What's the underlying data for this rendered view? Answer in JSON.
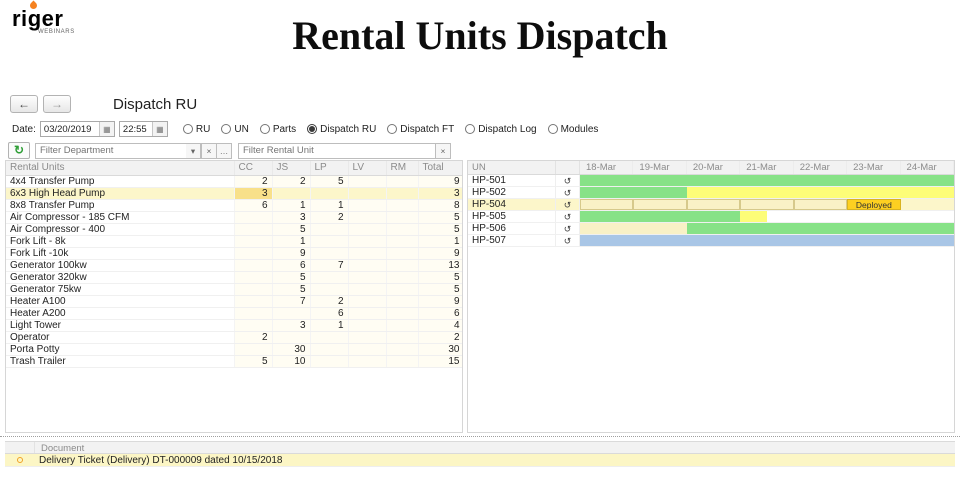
{
  "logo": {
    "text_pre": "ri",
    "text_mid": "g",
    "text_post": "er",
    "subtitle": "WEBINARS"
  },
  "page_title": "Rental Units Dispatch",
  "toolbar": {
    "title": "Dispatch RU"
  },
  "icons": {
    "back": "←",
    "forward": "→",
    "calendar": "▦",
    "refresh": "↻",
    "dropdown": "▾",
    "clear": "×",
    "choose": "…",
    "history": "↺"
  },
  "date_row": {
    "date_label": "Date:",
    "date_value": "03/20/2019",
    "time_value": "22:55",
    "radios": [
      {
        "label": "RU",
        "checked": false
      },
      {
        "label": "UN",
        "checked": false
      },
      {
        "label": "Parts",
        "checked": false
      },
      {
        "label": "Dispatch RU",
        "checked": true
      },
      {
        "label": "Dispatch FT",
        "checked": false
      },
      {
        "label": "Dispatch Log",
        "checked": false
      },
      {
        "label": "Modules",
        "checked": false
      }
    ]
  },
  "filters": {
    "department_placeholder": "Filter Department",
    "rental_unit_placeholder": "Filter Rental Unit"
  },
  "rental_table": {
    "columns": [
      "Rental Units",
      "CC",
      "JS",
      "LP",
      "LV",
      "RM",
      "Total"
    ],
    "rows": [
      {
        "name": "4x4 Transfer Pump",
        "cc": "2",
        "js": "2",
        "lp": "5",
        "lv": "",
        "rm": "",
        "total": "9"
      },
      {
        "name": "6x3 High Head Pump",
        "cc": "3",
        "js": "",
        "lp": "",
        "lv": "",
        "rm": "",
        "total": "3",
        "selected": true,
        "highlight_cell": "cc"
      },
      {
        "name": "8x8 Transfer Pump",
        "cc": "6",
        "js": "1",
        "lp": "1",
        "lv": "",
        "rm": "",
        "total": "8"
      },
      {
        "name": "Air Compressor - 185 CFM",
        "cc": "",
        "js": "3",
        "lp": "2",
        "lv": "",
        "rm": "",
        "total": "5"
      },
      {
        "name": "Air Compressor - 400",
        "cc": "",
        "js": "5",
        "lp": "",
        "lv": "",
        "rm": "",
        "total": "5"
      },
      {
        "name": "Fork Lift - 8k",
        "cc": "",
        "js": "1",
        "lp": "",
        "lv": "",
        "rm": "",
        "total": "1"
      },
      {
        "name": "Fork Lift -10k",
        "cc": "",
        "js": "9",
        "lp": "",
        "lv": "",
        "rm": "",
        "total": "9"
      },
      {
        "name": "Generator 100kw",
        "cc": "",
        "js": "6",
        "lp": "7",
        "lv": "",
        "rm": "",
        "total": "13"
      },
      {
        "name": "Generator 320kw",
        "cc": "",
        "js": "5",
        "lp": "",
        "lv": "",
        "rm": "",
        "total": "5"
      },
      {
        "name": "Generator 75kw",
        "cc": "",
        "js": "5",
        "lp": "",
        "lv": "",
        "rm": "",
        "total": "5"
      },
      {
        "name": "Heater A100",
        "cc": "",
        "js": "7",
        "lp": "2",
        "lv": "",
        "rm": "",
        "total": "9"
      },
      {
        "name": "Heater A200",
        "cc": "",
        "js": "",
        "lp": "6",
        "lv": "",
        "rm": "",
        "total": "6"
      },
      {
        "name": "Light Tower",
        "cc": "",
        "js": "3",
        "lp": "1",
        "lv": "",
        "rm": "",
        "total": "4"
      },
      {
        "name": "Operator",
        "cc": "2",
        "js": "",
        "lp": "",
        "lv": "",
        "rm": "",
        "total": "2"
      },
      {
        "name": "Porta Potty",
        "cc": "",
        "js": "30",
        "lp": "",
        "lv": "",
        "rm": "",
        "total": "30"
      },
      {
        "name": "Trash Trailer",
        "cc": "5",
        "js": "10",
        "lp": "",
        "lv": "",
        "rm": "",
        "total": "15"
      }
    ]
  },
  "gantt": {
    "un_header": "UN",
    "dates": [
      "18-Mar",
      "19-Mar",
      "20-Mar",
      "21-Mar",
      "22-Mar",
      "23-Mar",
      "24-Mar"
    ],
    "colors": {
      "green": "#87e287",
      "yellow": "#fdfd78",
      "cream": "#f9f1c6",
      "gold": "#fdd021",
      "blue": "#a9c6e6"
    },
    "rows": [
      {
        "unit": "HP-501",
        "bars": [
          {
            "start": 0,
            "end": 7,
            "color": "green"
          }
        ]
      },
      {
        "unit": "HP-502",
        "bars": [
          {
            "start": 0,
            "end": 2,
            "color": "green"
          },
          {
            "start": 2,
            "end": 7,
            "color": "yellow"
          }
        ]
      },
      {
        "unit": "HP-504",
        "selected": true,
        "bars": [
          {
            "start": 0,
            "end": 1,
            "color": "cream",
            "bordered": true
          },
          {
            "start": 1,
            "end": 2,
            "color": "cream",
            "bordered": true
          },
          {
            "start": 2,
            "end": 3,
            "color": "cream",
            "bordered": true
          },
          {
            "start": 3,
            "end": 4,
            "color": "cream",
            "bordered": true
          },
          {
            "start": 4,
            "end": 5,
            "color": "cream",
            "bordered": true
          },
          {
            "start": 5,
            "end": 6,
            "color": "gold",
            "bordered": true,
            "label": "Deployed"
          }
        ]
      },
      {
        "unit": "HP-505",
        "bars": [
          {
            "start": 0,
            "end": 3,
            "color": "green"
          },
          {
            "start": 3,
            "end": 3.5,
            "color": "yellow"
          }
        ]
      },
      {
        "unit": "HP-506",
        "bars": [
          {
            "start": 0,
            "end": 2,
            "color": "cream"
          },
          {
            "start": 2,
            "end": 7,
            "color": "green"
          }
        ]
      },
      {
        "unit": "HP-507",
        "bars": [
          {
            "start": 0,
            "end": 7,
            "color": "blue"
          }
        ]
      }
    ]
  },
  "document_panel": {
    "header": "Document",
    "rows": [
      {
        "text": "Delivery Ticket (Delivery) DT-000009 dated 10/15/2018"
      }
    ]
  }
}
